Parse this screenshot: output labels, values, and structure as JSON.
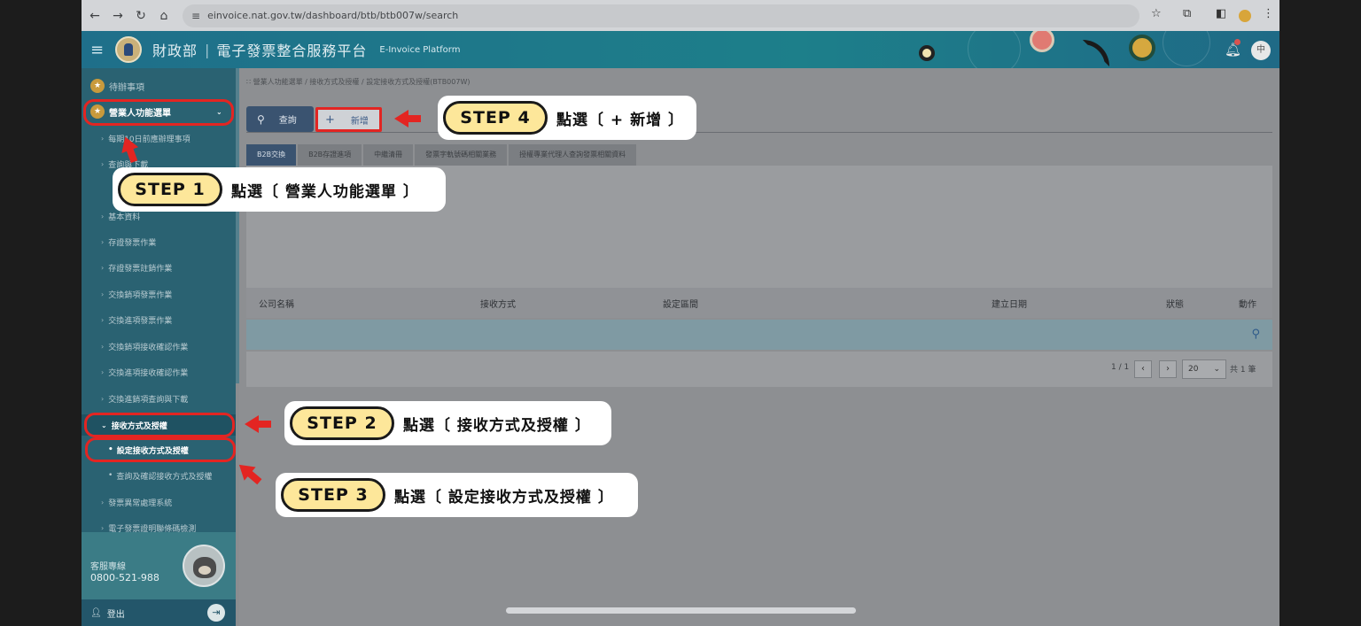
{
  "browser": {
    "url": "einvoice.nat.gov.tw/dashboard/btb/btb007w/search",
    "back": "←",
    "forward": "→",
    "reload": "↻",
    "home": "⌂",
    "star": "☆",
    "ext": "⧉",
    "panel": "◧",
    "menu": "⋮"
  },
  "header": {
    "org": "財政部",
    "platform": "電子發票整合服務平台",
    "platform_en": "E-Invoice Platform",
    "lang": "中"
  },
  "sidebar": {
    "todo": "待辦事項",
    "menu": "營業人功能選單",
    "items": [
      "每期10日前應辦理事項",
      "查詢與下載",
      "基本資料",
      "存證發票作業",
      "存證發票註銷作業",
      "交換銷項發票作業",
      "交換進項發票作業",
      "交換銷項接收確認作業",
      "交換進項接收確認作業",
      "交換進銷項查詢與下載"
    ],
    "receive": "接收方式及授權",
    "receive_set": "設定接收方式及授權",
    "receive_query": "查詢及確認接收方式及授權",
    "abnormal": "發票異常處理系統",
    "barcode": "電子發票證明聯條碼檢測",
    "hotline_label": "客服專線",
    "hotline": "0800-521-988",
    "logout": "登出"
  },
  "main": {
    "breadcrumb": "營業人功能選單 / 接收方式及授權 / 設定接收方式及授權(BTB007W)",
    "search_btn": "查詢",
    "add_btn": "新增",
    "tabs": [
      "B2B交換",
      "B2B存證進項",
      "中繼清冊",
      "發票字軌號碼相關業務",
      "授權專業代理人查詢發票相關資料"
    ],
    "columns": [
      "公司名稱",
      "接收方式",
      "設定區間",
      "建立日期",
      "狀態",
      "動作"
    ],
    "pager": {
      "page": "1 / 1",
      "size": "20",
      "total": "共 1 筆"
    }
  },
  "steps": [
    {
      "label": "STEP 1",
      "text": "點選〔 營業人功能選單 〕"
    },
    {
      "label": "STEP 2",
      "text": "點選〔 接收方式及授權 〕"
    },
    {
      "label": "STEP 3",
      "text": "點選〔 設定接收方式及授權 〕"
    },
    {
      "label": "STEP 4",
      "text": "點選〔 + 新增 〕"
    }
  ],
  "colors": {
    "highlight": "#e32522",
    "pill": "#fde79a",
    "header": "#1f6f8a"
  }
}
